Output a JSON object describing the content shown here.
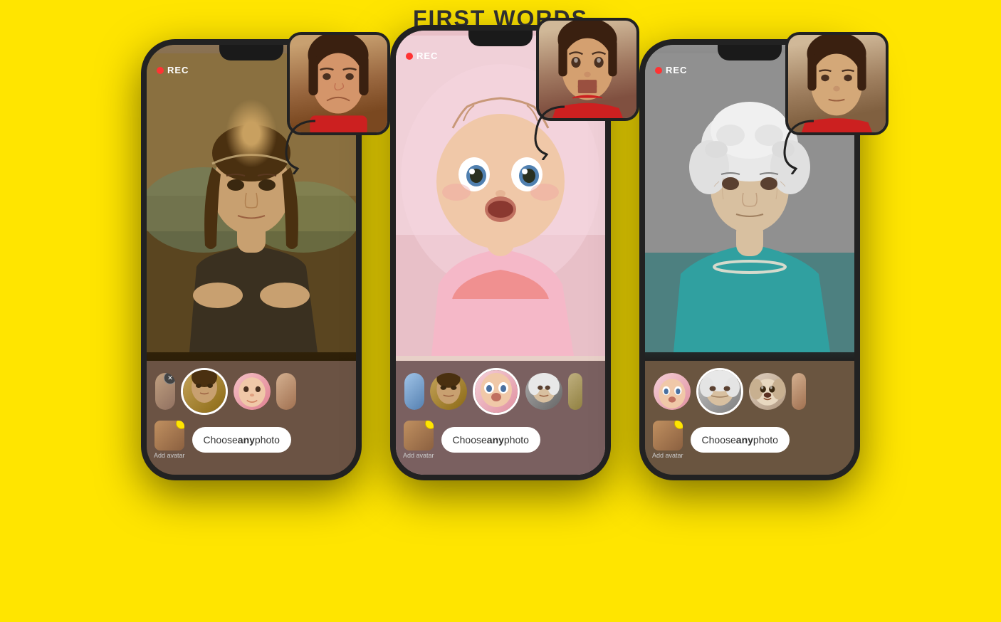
{
  "page": {
    "title": "FIRST WORDS",
    "background_color": "#FFE500"
  },
  "phones": [
    {
      "id": "phone-left",
      "screen_type": "mona",
      "rec_label": "REC",
      "floating_photo_description": "Woman frowning face photo",
      "bottom_bar": {
        "add_avatar_label": "Add avatar",
        "choose_photo_label": "Choose ",
        "choose_photo_bold": "any",
        "choose_photo_suffix": " photo",
        "thumbnails": [
          "person-partial",
          "person-close",
          "mona-active",
          "baby",
          "partial-right"
        ]
      }
    },
    {
      "id": "phone-center",
      "screen_type": "baby",
      "rec_label": "REC",
      "floating_photo_description": "Woman surprised face photo",
      "bottom_bar": {
        "add_avatar_label": "Add avatar",
        "choose_photo_label": "Choose ",
        "choose_photo_bold": "any",
        "choose_photo_suffix": " photo",
        "thumbnails": [
          "person-partial",
          "mona",
          "baby-active",
          "queen",
          "partial-right"
        ]
      }
    },
    {
      "id": "phone-right",
      "screen_type": "queen",
      "rec_label": "REC",
      "floating_photo_description": "Woman neutral face photo",
      "bottom_bar": {
        "add_avatar_label": "Add avatar",
        "choose_photo_label": "Choose ",
        "choose_photo_bold": "any",
        "choose_photo_suffix": " photo",
        "thumbnails": [
          "baby",
          "queen-active",
          "dog",
          "partial-right"
        ]
      }
    }
  ]
}
